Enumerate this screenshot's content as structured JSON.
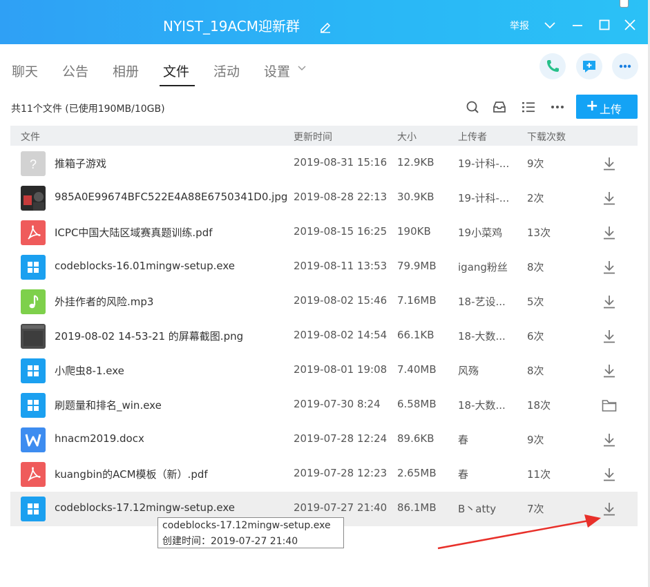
{
  "window": {
    "title": "NYIST_19ACM迎新群",
    "report_label": "举报"
  },
  "tabs": [
    {
      "label": "聊天"
    },
    {
      "label": "公告"
    },
    {
      "label": "相册"
    },
    {
      "label": "文件"
    },
    {
      "label": "活动"
    },
    {
      "label": "设置"
    }
  ],
  "active_tab": "文件",
  "summary": "共11个文件 (已使用190MB/10GB)",
  "upload_label": "上传",
  "columns": {
    "file": "文件",
    "updated": "更新时间",
    "size": "大小",
    "uploader": "上传者",
    "downloads": "下载次数"
  },
  "files": [
    {
      "name": "推箱子游戏",
      "date": "2019-08-31 15:16",
      "size": "12.9KB",
      "uploader": "19-计科-...",
      "count": "9次",
      "icon": "unknown-file-icon",
      "action": "download-icon"
    },
    {
      "name": "985A0E99674BFC522E4A88E6750341D0.jpg",
      "date": "2019-08-28 22:13",
      "size": "30.9KB",
      "uploader": "19-计科-...",
      "count": "2次",
      "icon": "image-thumbnail-icon",
      "action": "download-icon"
    },
    {
      "name": "ICPC中国大陆区域赛真题训练.pdf",
      "date": "2019-08-15 16:25",
      "size": "190KB",
      "uploader": "19小菜鸡",
      "count": "13次",
      "icon": "pdf-icon",
      "action": "download-icon"
    },
    {
      "name": "codeblocks-16.01mingw-setup.exe",
      "date": "2019-08-11 13:53",
      "size": "79.9MB",
      "uploader": "igang粉丝",
      "count": "8次",
      "icon": "windows-exe-icon",
      "action": "download-icon"
    },
    {
      "name": "外挂作者的风险.mp3",
      "date": "2019-08-02 15:46",
      "size": "7.16MB",
      "uploader": "18-艺设...",
      "count": "5次",
      "icon": "music-icon",
      "action": "download-icon"
    },
    {
      "name": "2019-08-02 14-53-21 的屏幕截图.png",
      "date": "2019-08-02 14:54",
      "size": "66.1KB",
      "uploader": "18-大数...",
      "count": "6次",
      "icon": "screenshot-thumbnail-icon",
      "action": "download-icon"
    },
    {
      "name": "小爬虫8-1.exe",
      "date": "2019-08-01 19:08",
      "size": "7.40MB",
      "uploader": "风殇",
      "count": "8次",
      "icon": "windows-exe-icon",
      "action": "download-icon"
    },
    {
      "name": "刷题量和排名_win.exe",
      "date": "2019-07-30 8:24",
      "size": "6.58MB",
      "uploader": "18-大数...",
      "count": "18次",
      "icon": "windows-exe-icon",
      "action": "folder-icon"
    },
    {
      "name": "hnacm2019.docx",
      "date": "2019-07-28 12:24",
      "size": "89.6KB",
      "uploader": "春",
      "count": "9次",
      "icon": "word-doc-icon",
      "action": "download-icon"
    },
    {
      "name": "kuangbin的ACM模板（新）.pdf",
      "date": "2019-07-28 12:23",
      "size": "2.65MB",
      "uploader": "春",
      "count": "11次",
      "icon": "pdf-icon",
      "action": "download-icon"
    },
    {
      "name": "codeblocks-17.12mingw-setup.exe",
      "date": "2019-07-27 21:40",
      "size": "86.1MB",
      "uploader": "B丶atty",
      "count": "7次",
      "icon": "windows-exe-icon",
      "action": "download-icon"
    }
  ],
  "tooltip": {
    "name": "codeblocks-17.12mingw-setup.exe",
    "created": "创建时间：2019-07-27 21:40"
  },
  "colors": {
    "title_bar": "#2ab6f6",
    "accent": "#14a3f5",
    "exe": "#1ba0f0",
    "pdf": "#ef5b5b",
    "music": "#7ed04b",
    "word": "#3d8cf0",
    "annotation_arrow": "#e8302a"
  }
}
